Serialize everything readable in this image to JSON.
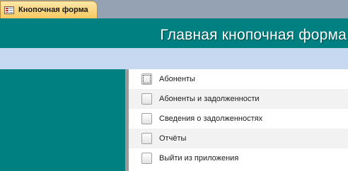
{
  "tab": {
    "icon": "form-icon",
    "label": "Кнопочная форма"
  },
  "header": {
    "title": "Главная кнопочная форма"
  },
  "colors": {
    "teal": "#008080",
    "subband": "#c6d9f1",
    "tab": "#f7c860"
  },
  "menu": {
    "items": [
      {
        "label": "Абоненты"
      },
      {
        "label": "Абоненты и задолженности"
      },
      {
        "label": "Сведения о задолженностях"
      },
      {
        "label": "Отчёты"
      },
      {
        "label": "Выйти из приложения"
      }
    ]
  }
}
